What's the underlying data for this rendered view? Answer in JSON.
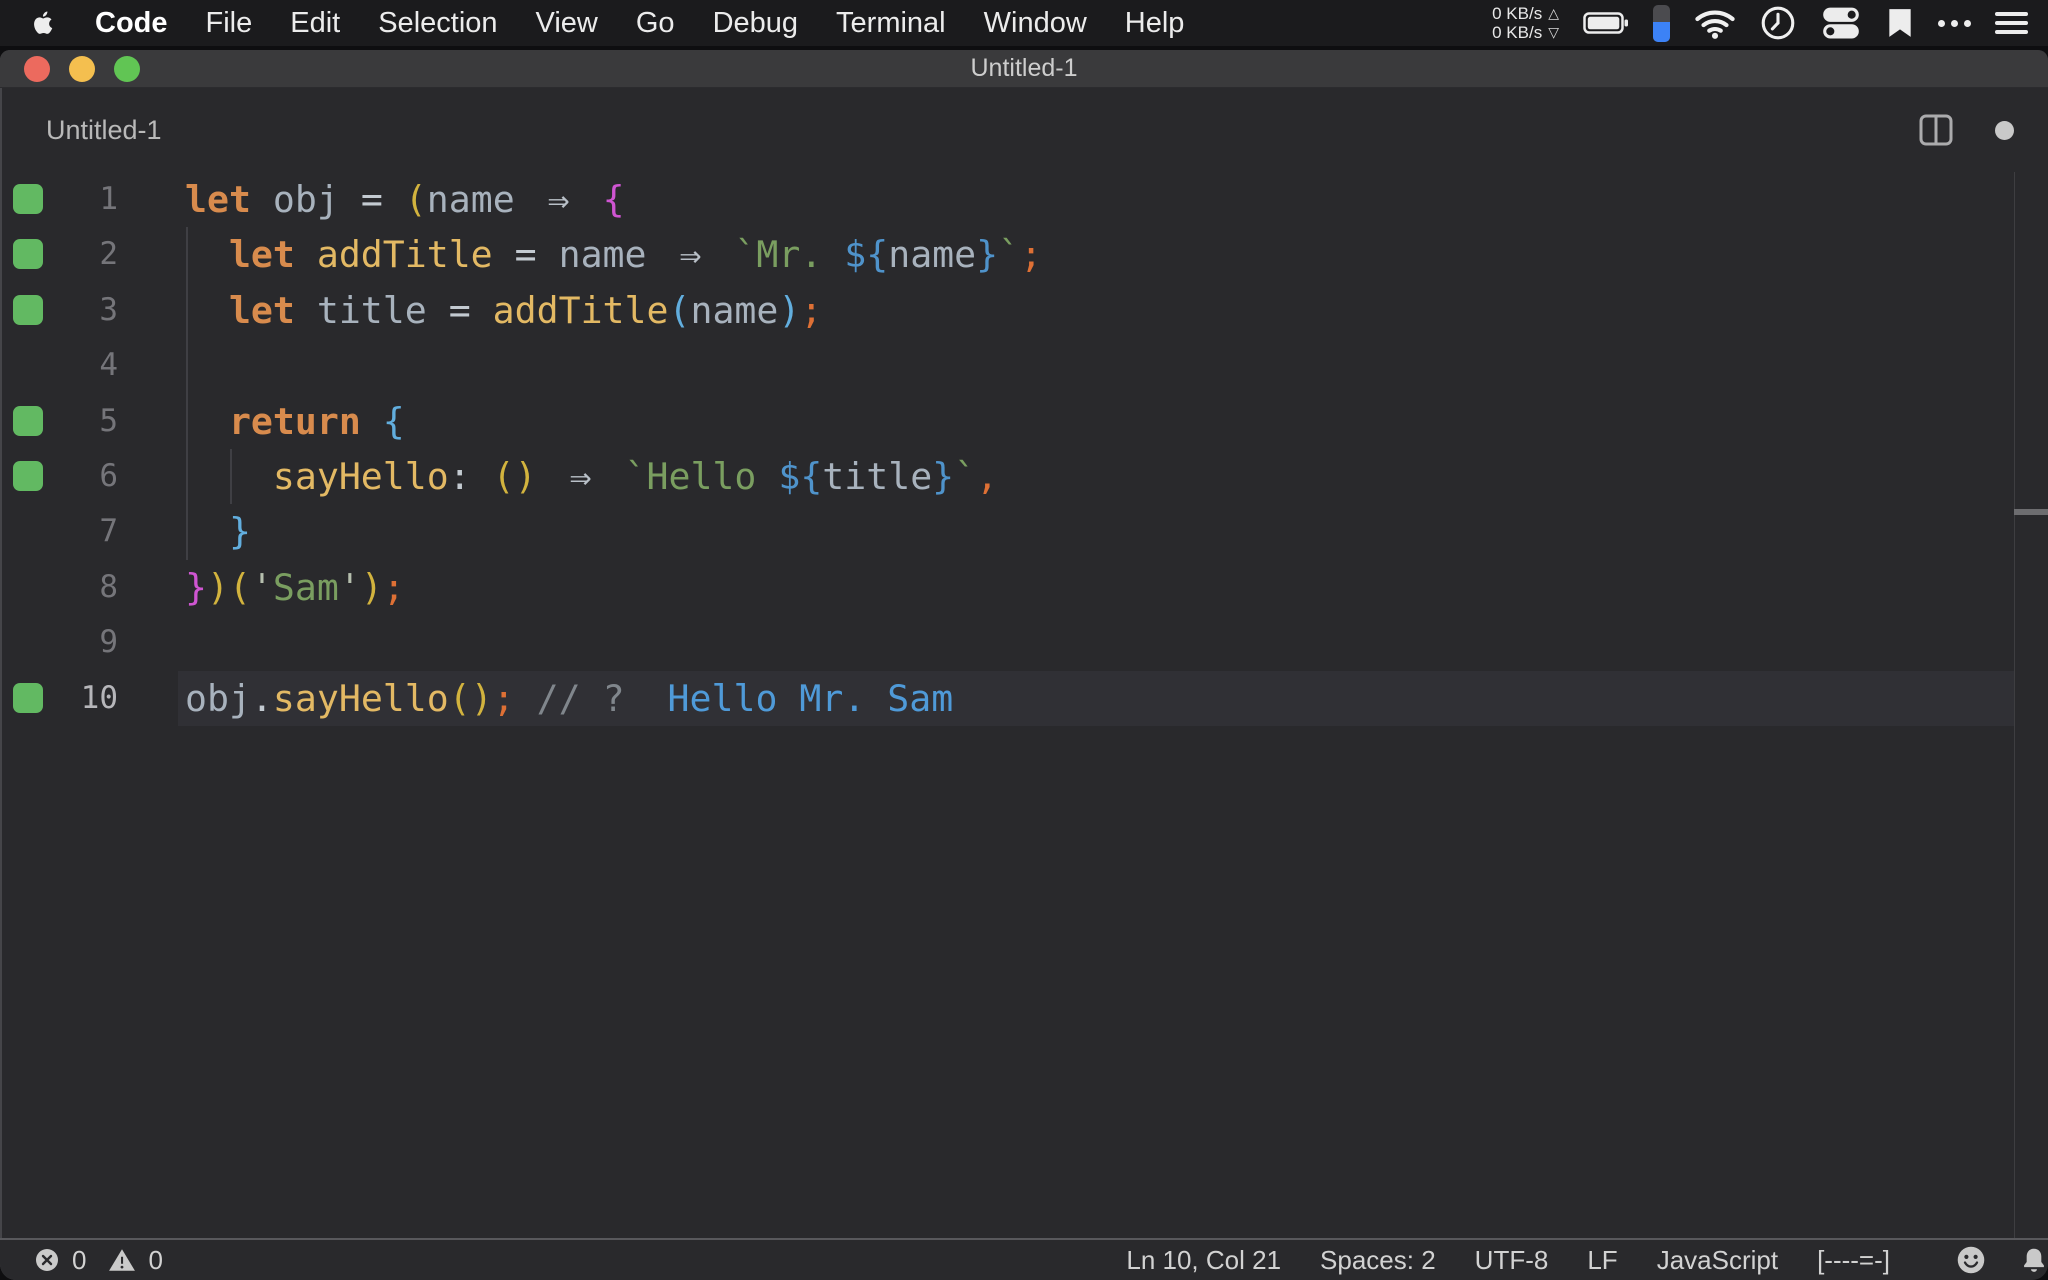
{
  "menu_bar": {
    "app_menu": "Code",
    "items": [
      "File",
      "Edit",
      "Selection",
      "View",
      "Go",
      "Debug",
      "Terminal",
      "Window",
      "Help"
    ],
    "network_up": "0 KB/s",
    "network_down": "0 KB/s"
  },
  "window": {
    "title": "Untitled-1"
  },
  "tab_bar": {
    "label": "Untitled-1"
  },
  "editor": {
    "language_hint": "JavaScript",
    "active_line": 10,
    "lines": [
      {
        "num": "1",
        "coverage": true,
        "guides": [],
        "tokens": [
          [
            "kw",
            "let"
          ],
          [
            "var",
            " obj"
          ],
          [
            "op",
            " = "
          ],
          [
            "b1",
            "("
          ],
          [
            "var",
            "name"
          ],
          [
            "op",
            " "
          ],
          [
            "arr",
            "⇒"
          ],
          [
            "op",
            " "
          ],
          [
            "b2",
            "{"
          ]
        ]
      },
      {
        "num": "2",
        "coverage": true,
        "guides": [
          0
        ],
        "tokens": [
          [
            "kw",
            "  let"
          ],
          [
            "fn",
            " addTitle"
          ],
          [
            "op",
            " = "
          ],
          [
            "var",
            "name"
          ],
          [
            "op",
            " "
          ],
          [
            "arr",
            "⇒"
          ],
          [
            "op",
            " "
          ],
          [
            "str",
            "`Mr. "
          ],
          [
            "tpl",
            "${"
          ],
          [
            "var",
            "name"
          ],
          [
            "tpl",
            "}"
          ],
          [
            "str",
            "`"
          ],
          [
            "sem",
            ";"
          ]
        ]
      },
      {
        "num": "3",
        "coverage": true,
        "guides": [
          0
        ],
        "tokens": [
          [
            "kw",
            "  let"
          ],
          [
            "var",
            " title"
          ],
          [
            "op",
            " = "
          ],
          [
            "fn",
            "addTitle"
          ],
          [
            "b3",
            "("
          ],
          [
            "var",
            "name"
          ],
          [
            "b3",
            ")"
          ],
          [
            "sem",
            ";"
          ]
        ]
      },
      {
        "num": "4",
        "coverage": false,
        "guides": [
          0
        ],
        "tokens": []
      },
      {
        "num": "5",
        "coverage": true,
        "guides": [
          0
        ],
        "tokens": [
          [
            "kw",
            "  return"
          ],
          [
            "b3",
            " {"
          ]
        ]
      },
      {
        "num": "6",
        "coverage": true,
        "guides": [
          0,
          1
        ],
        "tokens": [
          [
            "fn",
            "    sayHello"
          ],
          [
            "op",
            ": "
          ],
          [
            "b1",
            "()"
          ],
          [
            "op",
            " "
          ],
          [
            "arr",
            "⇒"
          ],
          [
            "op",
            " "
          ],
          [
            "str",
            "`Hello "
          ],
          [
            "tpl",
            "${"
          ],
          [
            "var",
            "title"
          ],
          [
            "tpl",
            "}"
          ],
          [
            "str",
            "`"
          ],
          [
            "sem",
            ","
          ]
        ]
      },
      {
        "num": "7",
        "coverage": false,
        "guides": [
          0
        ],
        "tokens": [
          [
            "b3",
            "  }"
          ]
        ]
      },
      {
        "num": "8",
        "coverage": false,
        "guides": [],
        "tokens": [
          [
            "b2",
            "}"
          ],
          [
            "b1",
            ")("
          ],
          [
            "q",
            "'"
          ],
          [
            "str",
            "Sam"
          ],
          [
            "q",
            "'"
          ],
          [
            "b1",
            ")"
          ],
          [
            "sem",
            ";"
          ]
        ]
      },
      {
        "num": "9",
        "coverage": false,
        "guides": [],
        "tokens": []
      },
      {
        "num": "10",
        "coverage": true,
        "guides": [],
        "tokens": [
          [
            "var",
            "obj"
          ],
          [
            "op",
            "."
          ],
          [
            "fn",
            "sayHello"
          ],
          [
            "b1",
            "()"
          ],
          [
            "sem",
            ";"
          ],
          [
            "cmt",
            " // ?"
          ]
        ],
        "annotation": "Hello Mr. Sam"
      }
    ]
  },
  "status_bar": {
    "errors": "0",
    "warnings": "0",
    "items": [
      "Ln 10, Col 21",
      "Spaces: 2",
      "UTF-8",
      "LF",
      "JavaScript",
      "[----=-]"
    ]
  },
  "colors": {
    "keyword": "#d88b4d",
    "function_name": "#e3b964",
    "variable": "#a8b2bd",
    "operator": "#c3cad1",
    "string": "#7a9e60",
    "template_brace": "#4f93cb",
    "punctuation": "#de7035",
    "comment": "#80868c",
    "quokka_value": "#4f9ad8",
    "bracket_level1": "#d2b33e",
    "bracket_level2": "#cf55d2",
    "bracket_level3": "#62aede",
    "coverage_green": "#62b962",
    "device_battery_blue": "#3c82f6",
    "traffic_red": "#ec6a5e",
    "traffic_yellow": "#f4bf4f",
    "traffic_green": "#61c554"
  }
}
